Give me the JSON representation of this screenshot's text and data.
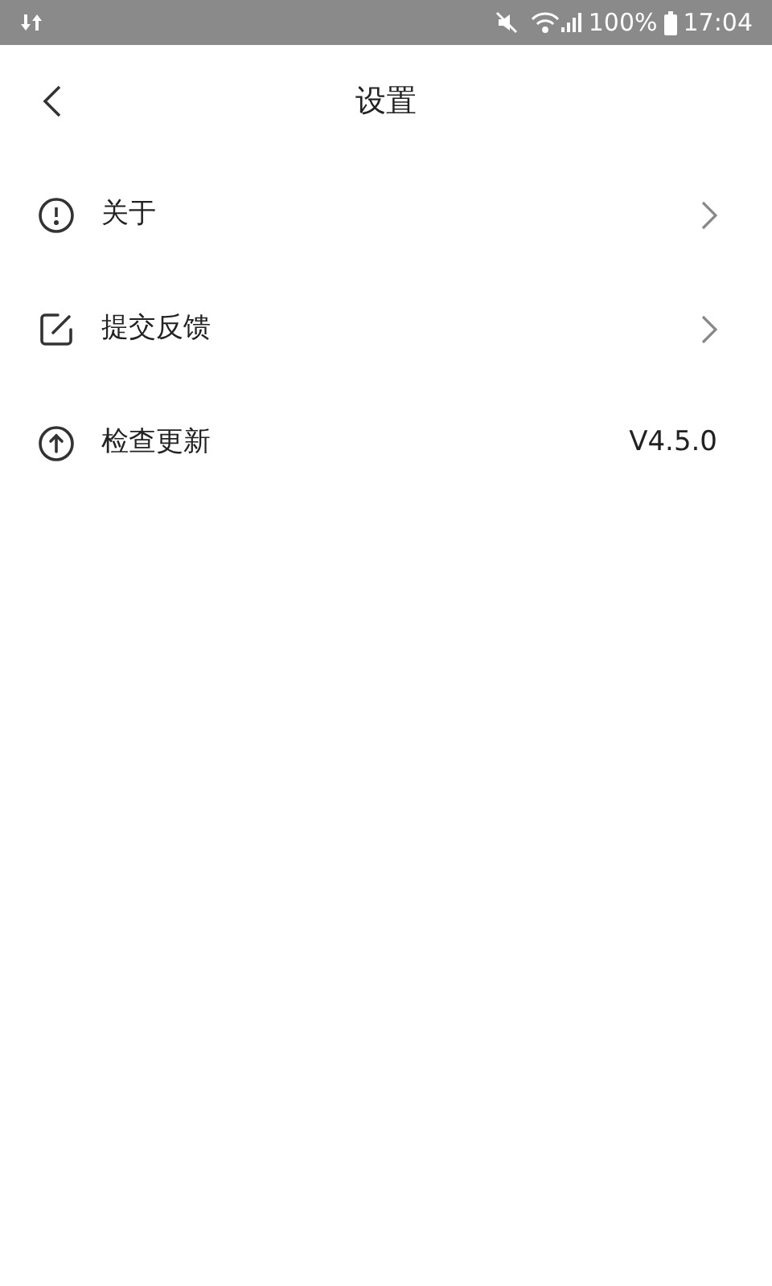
{
  "status_bar": {
    "battery": "100%",
    "time": "17:04"
  },
  "header": {
    "title": "设置"
  },
  "items": [
    {
      "label": "关于",
      "kind": "link"
    },
    {
      "label": "提交反馈",
      "kind": "link"
    },
    {
      "label": "检查更新",
      "kind": "value",
      "value": "V4.5.0"
    }
  ]
}
